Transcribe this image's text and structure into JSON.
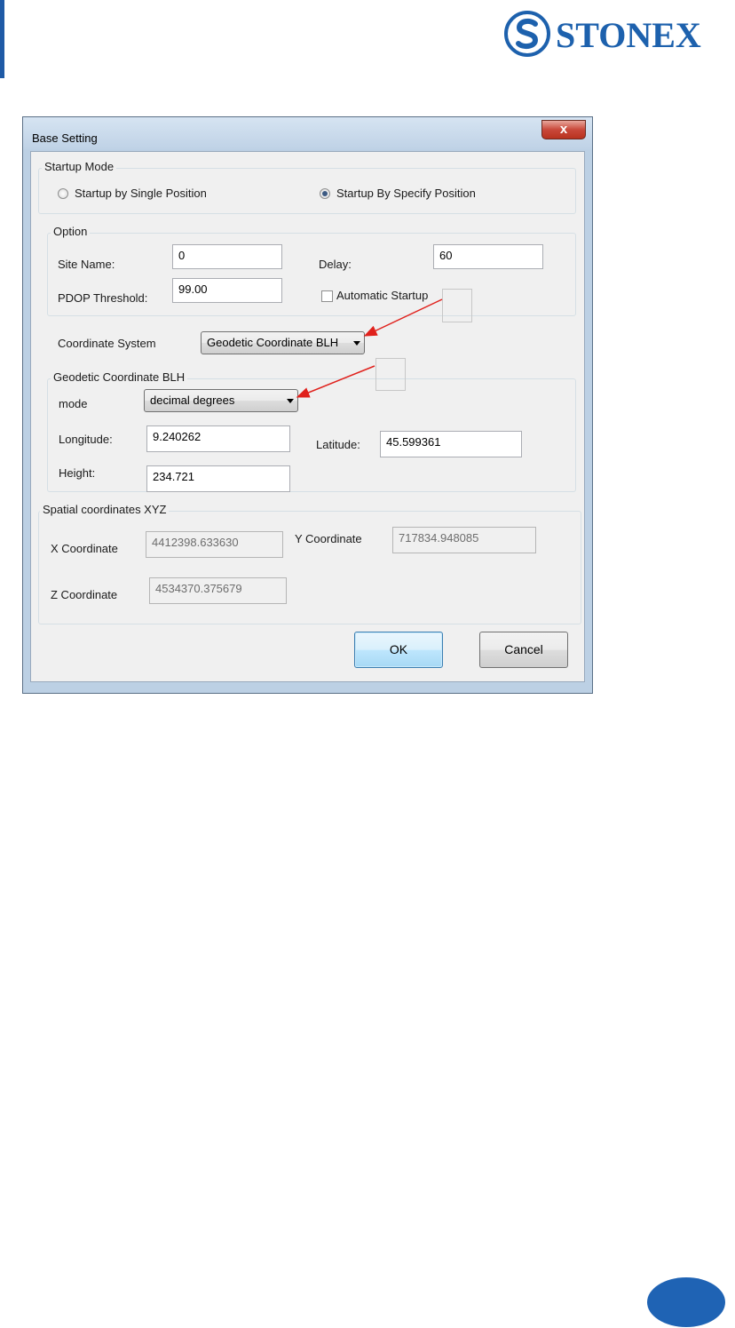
{
  "brand": {
    "name": "STONEX",
    "color": "#1d61ad"
  },
  "dialog": {
    "title": "Base Setting",
    "close_glyph": "x",
    "startup_mode": {
      "legend": "Startup Mode",
      "option_single": "Startup by Single Position",
      "option_specify": "Startup By Specify Position",
      "selected": "option_specify"
    },
    "option": {
      "legend": "Option",
      "site_name_label": "Site Name:",
      "site_name_value": "0",
      "delay_label": "Delay:",
      "delay_value": "60",
      "pdop_label": "PDOP Threshold:",
      "pdop_value": "99.00",
      "auto_startup_label": "Automatic Startup",
      "auto_startup_checked": false
    },
    "coordinate_system": {
      "label": "Coordinate System",
      "selected": "Geodetic Coordinate BLH"
    },
    "geodetic": {
      "legend": "Geodetic Coordinate BLH",
      "mode_label": "mode",
      "mode_selected": "decimal degrees",
      "longitude_label": "Longitude:",
      "longitude_value": "9.240262",
      "latitude_label": "Latitude:",
      "latitude_value": "45.599361",
      "height_label": "Height:",
      "height_value": "234.721"
    },
    "spatial": {
      "legend": "Spatial coordinates XYZ",
      "x_label": "X Coordinate",
      "x_value": "4412398.633630",
      "y_label": "Y Coordinate",
      "y_value": "717834.948085",
      "z_label": "Z Coordinate",
      "z_value": "4534370.375679"
    },
    "buttons": {
      "ok": "OK",
      "cancel": "Cancel"
    }
  },
  "colors": {
    "accent_blue": "#1f63b4",
    "annotation_arrow": "#e0211c"
  }
}
